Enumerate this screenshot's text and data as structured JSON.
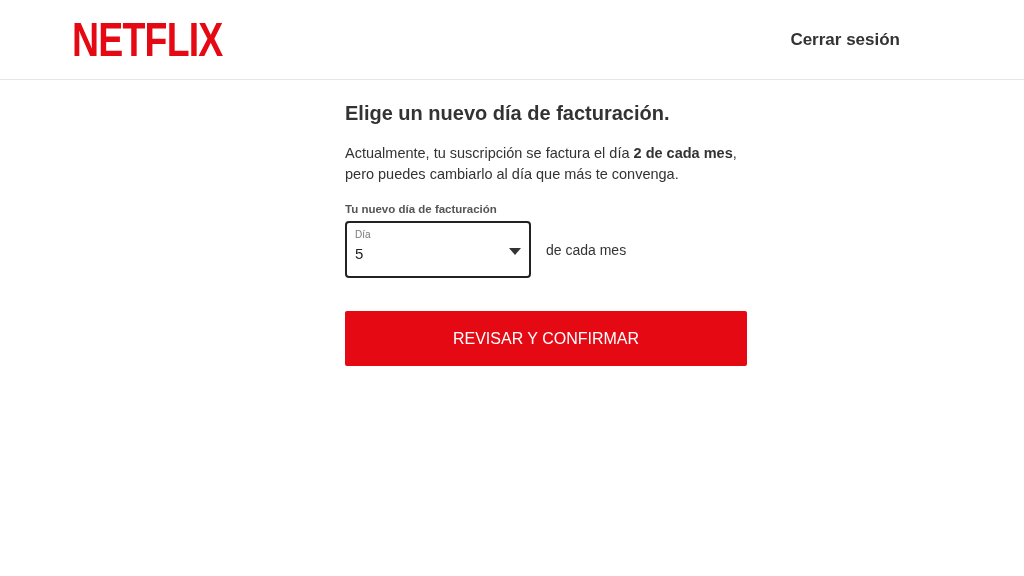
{
  "header": {
    "logo": "NETFLIX",
    "sign_out": "Cerrar sesión"
  },
  "title": "Elige un nuevo día de facturación.",
  "description": "Actualmente, tu suscripción se factura el día **2 de cada mes**, pero puedes cambiarlo al día que más te convenga.",
  "field_label": "Tu nuevo día de facturación",
  "day_select": {
    "label": "Día",
    "value": "5"
  },
  "suffix": "de cada mes",
  "button": "REVISAR Y CONFIRMAR"
}
